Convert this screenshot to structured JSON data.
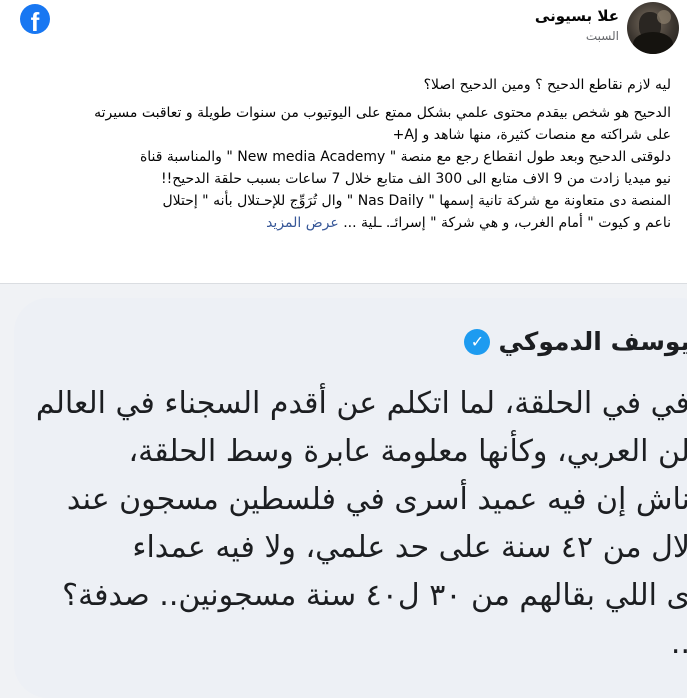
{
  "app": {
    "logo": "f",
    "logo_icon": "facebook-logo-icon",
    "brand_color": "#1877f2"
  },
  "post": {
    "author": "علا بسيونى",
    "time": "السبت",
    "heading": "ليه لازم نقاطع الدحيح ؟ ومين الدحيح اصلا؟",
    "lines": [
      "الدحيح هو شخص بيقدم محتوى علمي بشكل ممتع على اليوتيوب من سنوات طويلة و تعاقبت مسيرته",
      "على شراكته مع منصات كثيرة، منها شاهد و AJ+",
      "دلوقتى الدحيح وبعد طول انقطاع رجع مع منصة \" New media Academy \" والمناسبة قناة",
      "نيو ميديا زادت من 9 الاف متابع الى 300 الف متابع خلال 7 ساعات بسبب حلقة الدحيح!!",
      "المنصة دى متعاونة مع شركة تانية إسمها \" Nas Daily \" وال تُرَوِّج للإحـتلال بأنه \" إحتلال",
      "ناعم و كيوت \" أمام الغرب، و هي شركة \" إسرائـ. ـلية ..."
    ],
    "see_more": "عرض المزيد"
  },
  "quote": {
    "author": "يوسف الدموكي",
    "verified_icon": "verified-badge-icon",
    "verified_color": "#1d9bf0",
    "lines": [
      "في في الحلقة، لما اتكلم عن أقدم السجناء في العالم",
      "لن العربي، وكأنها معلومة عابرة وسط الحلقة،",
      "ناش إن فيه عميد أسرى في فلسطين مسجون عند",
      "لال من ٤٢ سنة على حد علمي، ولا فيه عمداء",
      "ى اللي بقالهم من ٣٠ ل٤٠ سنة مسجونين.. صدفة؟",
      ".."
    ]
  }
}
